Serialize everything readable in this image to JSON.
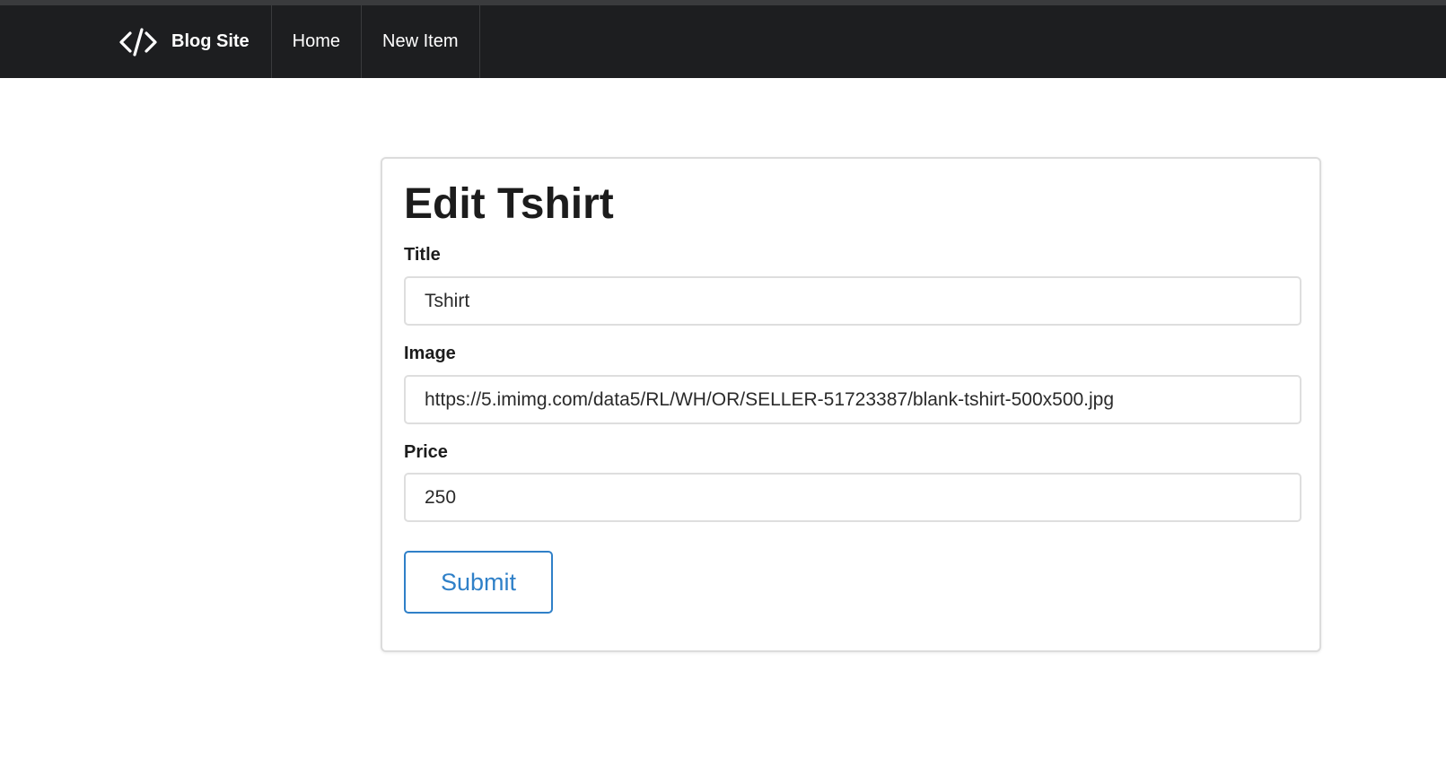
{
  "navbar": {
    "brand_icon": "code-brackets-icon",
    "brand_label": "Blog Site",
    "items": [
      {
        "label": "Home"
      },
      {
        "label": "New Item"
      }
    ]
  },
  "form": {
    "title": "Edit Tshirt",
    "fields": {
      "title": {
        "label": "Title",
        "value": "Tshirt"
      },
      "image": {
        "label": "Image",
        "value": "https://5.imimg.com/data5/RL/WH/OR/SELLER-51723387/blank-tshirt-500x500.jpg"
      },
      "price": {
        "label": "Price",
        "value": "250"
      }
    },
    "submit_label": "Submit"
  },
  "colors": {
    "navbar_bg": "#1d1e20",
    "accent": "#2f80c8"
  }
}
